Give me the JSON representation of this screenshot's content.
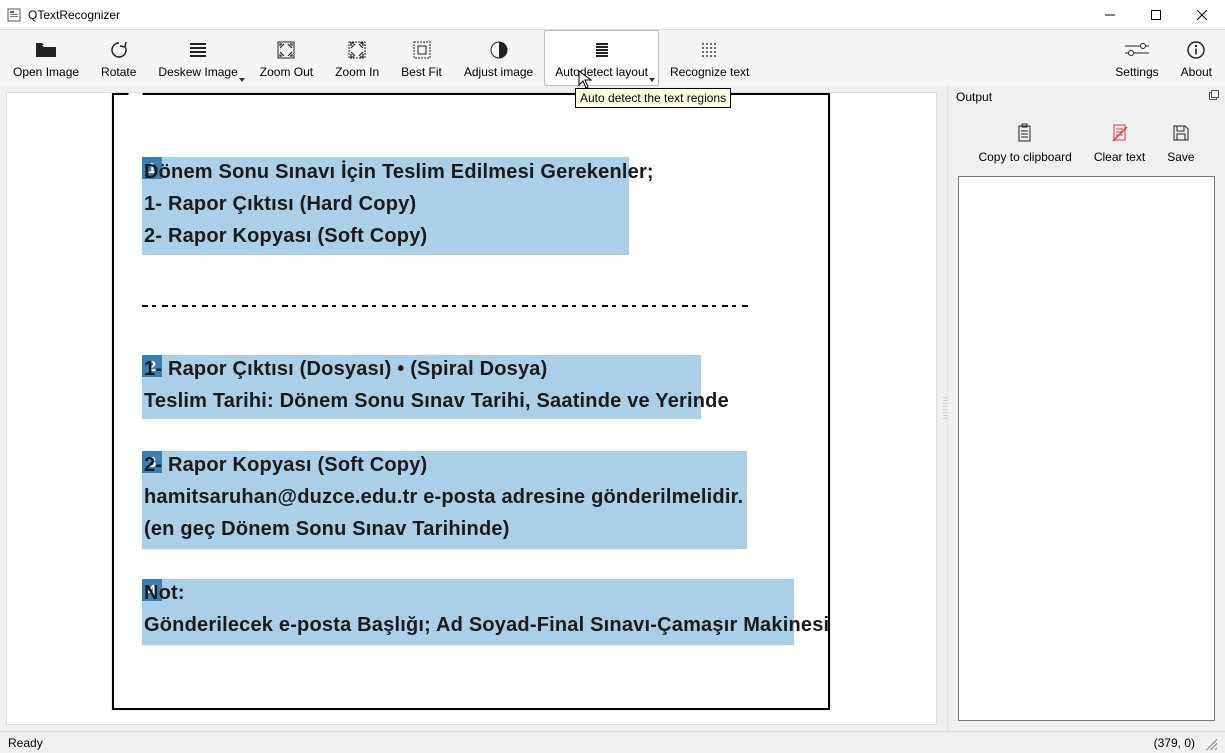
{
  "window": {
    "title": "QTextRecognizer"
  },
  "toolbar": {
    "open_image": "Open Image",
    "rotate": "Rotate",
    "deskew_image": "Deskew Image",
    "zoom_out": "Zoom Out",
    "zoom_in": "Zoom In",
    "best_fit": "Best Fit",
    "adjust_image": "Adjust image",
    "autodetect_layout": "Autodetect layout",
    "recognize_text": "Recognize text",
    "settings": "Settings",
    "about": "About"
  },
  "tooltip": "Auto detect the text regions",
  "output": {
    "title": "Output",
    "copy": "Copy to clipboard",
    "clear": "Clear text",
    "save": "Save",
    "text": ""
  },
  "statusbar": {
    "ready": "Ready",
    "coords": "(379, 0)"
  },
  "document": {
    "regions": [
      {
        "num": "1",
        "lines": [
          "Dönem Sonu Sınavı İçin Teslim Edilmesi Gerekenler;",
          "1- Rapor Çıktısı (Hard Copy)",
          "2- Rapor Kopyası (Soft Copy)"
        ]
      },
      {
        "num": "2",
        "lines": [
          "1- Rapor Çıktısı (Dosyası)   •    (Spiral Dosya)",
          "Teslim Tarihi: Dönem Sonu Sınav Tarihi, Saatinde ve Yerinde"
        ]
      },
      {
        "num": "3",
        "lines": [
          "2- Rapor Kopyası (Soft Copy)",
          "hamitsaruhan@duzce.edu.tr       e-posta adresine gönderilmelidir.",
          "(en geç Dönem Sonu Sınav Tarihinde)"
        ]
      },
      {
        "num": "4",
        "lines": [
          "Not:",
          "Gönderilecek e-posta Başlığı; Ad Soyad-Final Sınavı-Çamaşır Makinesi"
        ]
      }
    ]
  }
}
